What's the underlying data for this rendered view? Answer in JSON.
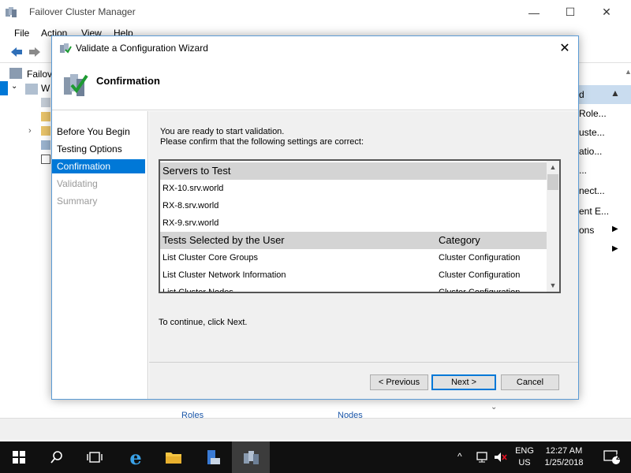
{
  "main_window": {
    "title": "Failover Cluster Manager",
    "menu": [
      "File",
      "Action",
      "View",
      "Help"
    ],
    "tree_partial": [
      "Failover",
      "W"
    ],
    "actions_partial": [
      "d",
      "Role...",
      "uste...",
      "atio...",
      "...",
      "nect...",
      "ent E...",
      "ons"
    ],
    "bottom_links": [
      "Roles",
      "Nodes"
    ]
  },
  "dialog": {
    "title": "Validate a Configuration Wizard",
    "header": "Confirmation",
    "steps": [
      {
        "label": "Before You Begin",
        "state": "normal"
      },
      {
        "label": "Testing Options",
        "state": "normal"
      },
      {
        "label": "Confirmation",
        "state": "active"
      },
      {
        "label": "Validating",
        "state": "disabled"
      },
      {
        "label": "Summary",
        "state": "disabled"
      }
    ],
    "intro_line1": "You are ready to start validation.",
    "intro_line2": "Please confirm that the following settings are correct:",
    "servers_header": "Servers to Test",
    "servers": [
      "RX-10.srv.world",
      "RX-8.srv.world",
      "RX-9.srv.world"
    ],
    "tests_header": "Tests Selected by the User",
    "category_header": "Category",
    "tests": [
      {
        "name": "List Cluster Core Groups",
        "category": "Cluster Configuration"
      },
      {
        "name": "List Cluster Network Information",
        "category": "Cluster Configuration"
      },
      {
        "name": "List Cluster Nodes",
        "category": "Cluster Configuration"
      }
    ],
    "continue_text": "To continue, click Next.",
    "buttons": {
      "previous": "< Previous",
      "next": "Next >",
      "cancel": "Cancel"
    }
  },
  "taskbar": {
    "lang_line1": "ENG",
    "lang_line2": "US",
    "time": "12:27 AM",
    "date": "1/25/2018",
    "notifications": "2"
  },
  "colors": {
    "accent": "#0078d7",
    "taskbar": "#101010",
    "section_bg": "#d4d4d4"
  }
}
